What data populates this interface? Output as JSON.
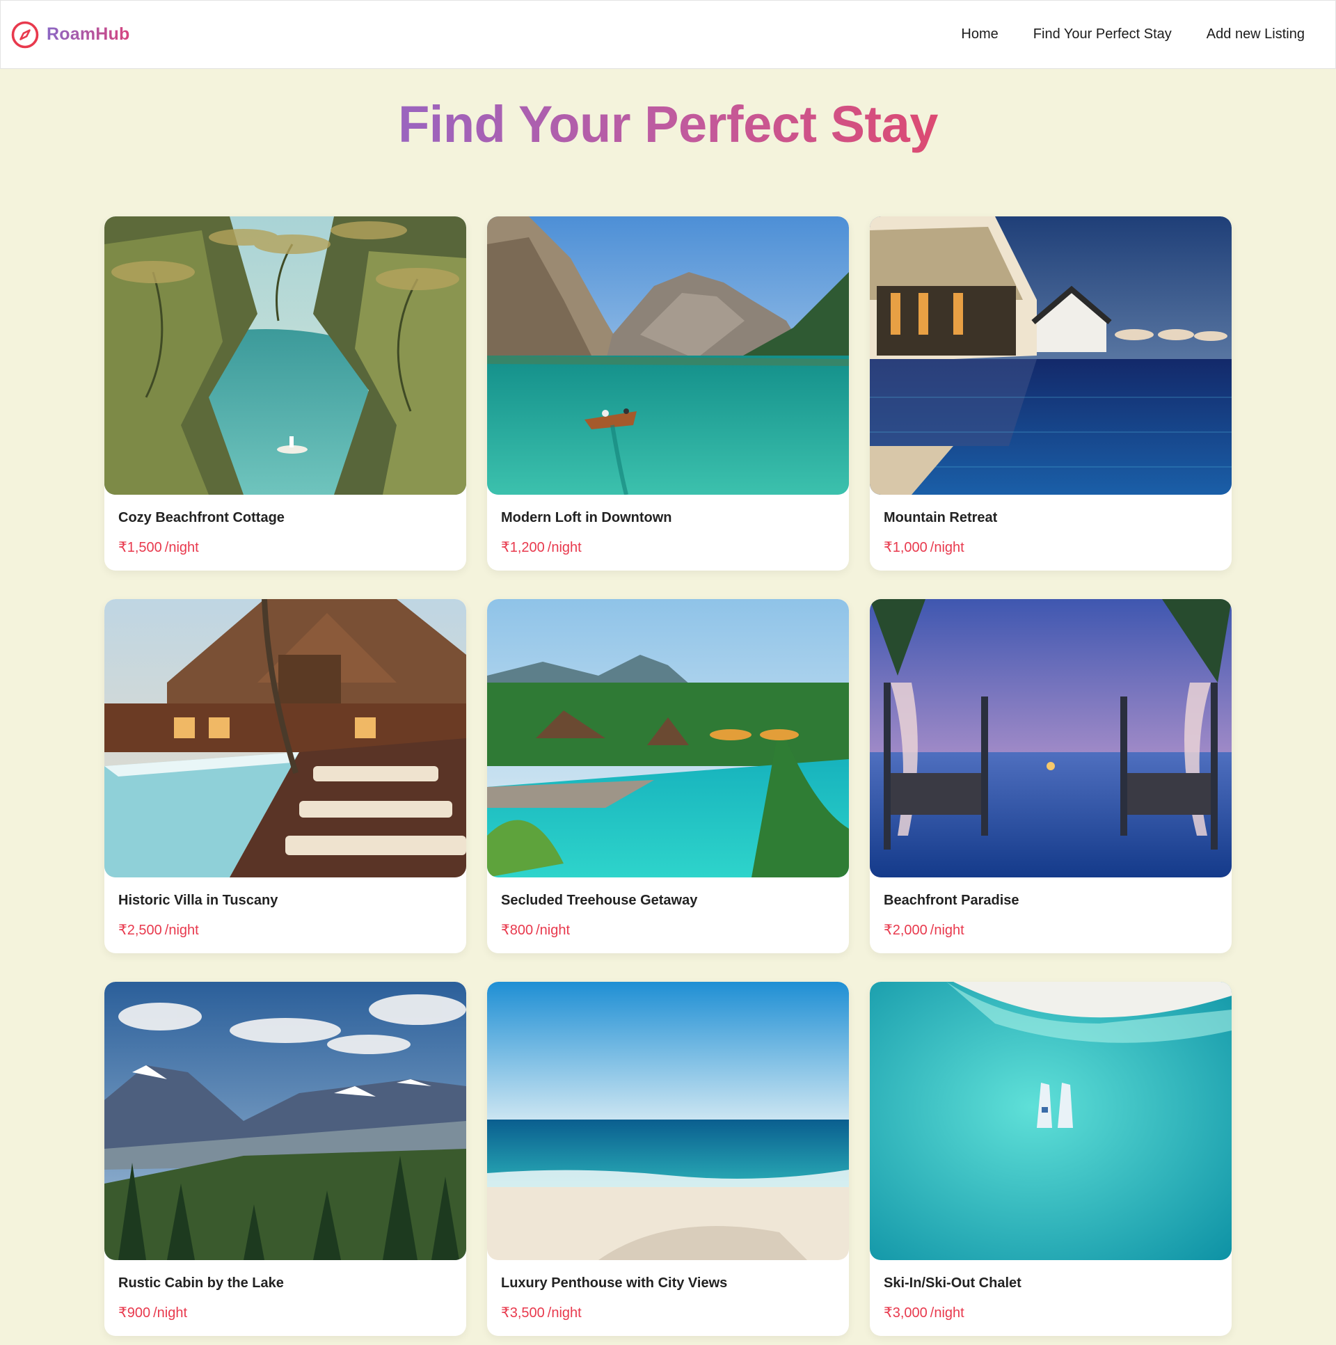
{
  "brand": {
    "name": "RoamHub",
    "icon": "compass-icon",
    "color": "#e8394d"
  },
  "nav": {
    "links": [
      "Home",
      "Find Your Perfect Stay",
      "Add new Listing"
    ]
  },
  "page": {
    "title": "Find Your Perfect Stay"
  },
  "colors": {
    "background": "#f4f3dc",
    "price": "#e8394d",
    "title_gradient": [
      "#9a64bf",
      "#dc4a72"
    ]
  },
  "listings": [
    {
      "title": "Cozy Beachfront Cottage",
      "price": "₹1,500",
      "unit": "/night"
    },
    {
      "title": "Modern Loft in Downtown",
      "price": "₹1,200",
      "unit": "/night"
    },
    {
      "title": "Mountain Retreat",
      "price": "₹1,000",
      "unit": "/night"
    },
    {
      "title": "Historic Villa in Tuscany",
      "price": "₹2,500",
      "unit": "/night"
    },
    {
      "title": "Secluded Treehouse Getaway",
      "price": "₹800",
      "unit": "/night"
    },
    {
      "title": "Beachfront Paradise",
      "price": "₹2,000",
      "unit": "/night"
    },
    {
      "title": "Rustic Cabin by the Lake",
      "price": "₹900",
      "unit": "/night"
    },
    {
      "title": "Luxury Penthouse with City Views",
      "price": "₹3,500",
      "unit": "/night"
    },
    {
      "title": "Ski-In/Ski-Out Chalet",
      "price": "₹3,000",
      "unit": "/night"
    }
  ]
}
